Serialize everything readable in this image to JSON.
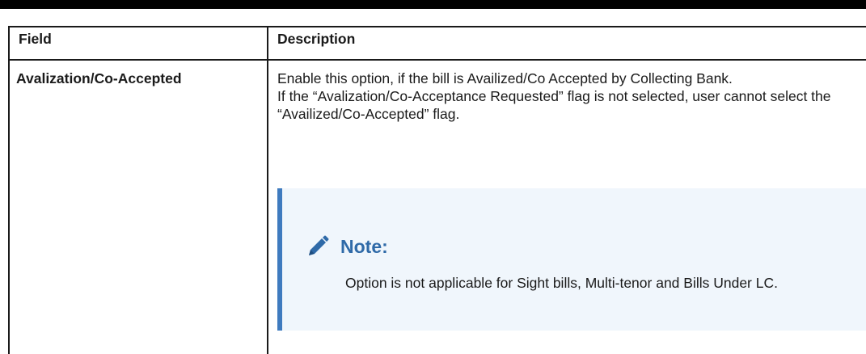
{
  "table": {
    "headers": {
      "field": "Field",
      "description": "Description"
    },
    "rows": [
      {
        "field": "Avalization/Co-Accepted",
        "description_lines": [
          "Enable this option, if the bill is Availized/Co Accepted by Collecting Bank.",
          "If the “Avalization/Co-Acceptance Requested” flag is not selected, user cannot select the “Availized/Co-Accepted” flag."
        ],
        "note": {
          "title": "Note:",
          "icon": "pencil-icon",
          "text": "Option is not applicable for Sight bills, Multi-tenor and Bills Under LC."
        }
      }
    ]
  },
  "colors": {
    "note_accent": "#3f7bbf",
    "note_background": "#f0f6fc",
    "note_title": "#2f6aa8"
  }
}
